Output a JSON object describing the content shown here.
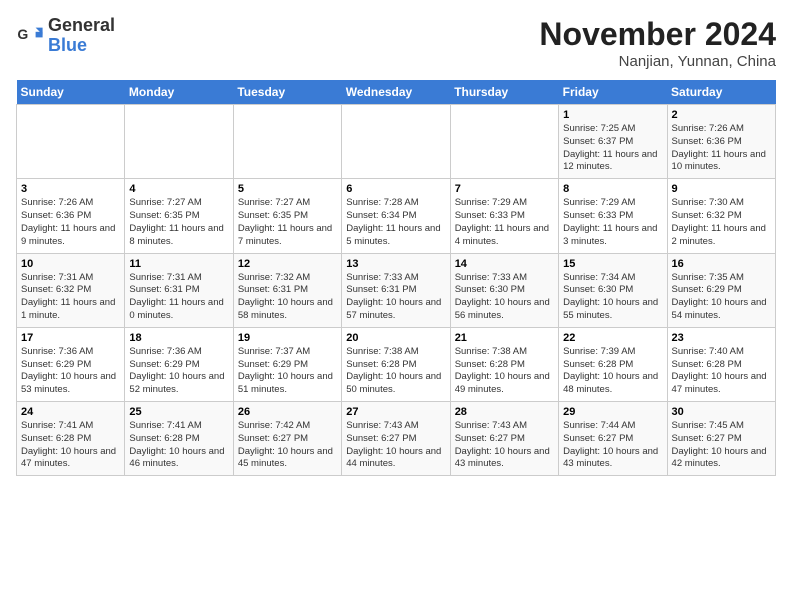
{
  "header": {
    "logo_general": "General",
    "logo_blue": "Blue",
    "month_title": "November 2024",
    "location": "Nanjian, Yunnan, China"
  },
  "days_of_week": [
    "Sunday",
    "Monday",
    "Tuesday",
    "Wednesday",
    "Thursday",
    "Friday",
    "Saturday"
  ],
  "weeks": [
    [
      {
        "day": "",
        "info": ""
      },
      {
        "day": "",
        "info": ""
      },
      {
        "day": "",
        "info": ""
      },
      {
        "day": "",
        "info": ""
      },
      {
        "day": "",
        "info": ""
      },
      {
        "day": "1",
        "info": "Sunrise: 7:25 AM\nSunset: 6:37 PM\nDaylight: 11 hours and 12 minutes."
      },
      {
        "day": "2",
        "info": "Sunrise: 7:26 AM\nSunset: 6:36 PM\nDaylight: 11 hours and 10 minutes."
      }
    ],
    [
      {
        "day": "3",
        "info": "Sunrise: 7:26 AM\nSunset: 6:36 PM\nDaylight: 11 hours and 9 minutes."
      },
      {
        "day": "4",
        "info": "Sunrise: 7:27 AM\nSunset: 6:35 PM\nDaylight: 11 hours and 8 minutes."
      },
      {
        "day": "5",
        "info": "Sunrise: 7:27 AM\nSunset: 6:35 PM\nDaylight: 11 hours and 7 minutes."
      },
      {
        "day": "6",
        "info": "Sunrise: 7:28 AM\nSunset: 6:34 PM\nDaylight: 11 hours and 5 minutes."
      },
      {
        "day": "7",
        "info": "Sunrise: 7:29 AM\nSunset: 6:33 PM\nDaylight: 11 hours and 4 minutes."
      },
      {
        "day": "8",
        "info": "Sunrise: 7:29 AM\nSunset: 6:33 PM\nDaylight: 11 hours and 3 minutes."
      },
      {
        "day": "9",
        "info": "Sunrise: 7:30 AM\nSunset: 6:32 PM\nDaylight: 11 hours and 2 minutes."
      }
    ],
    [
      {
        "day": "10",
        "info": "Sunrise: 7:31 AM\nSunset: 6:32 PM\nDaylight: 11 hours and 1 minute."
      },
      {
        "day": "11",
        "info": "Sunrise: 7:31 AM\nSunset: 6:31 PM\nDaylight: 11 hours and 0 minutes."
      },
      {
        "day": "12",
        "info": "Sunrise: 7:32 AM\nSunset: 6:31 PM\nDaylight: 10 hours and 58 minutes."
      },
      {
        "day": "13",
        "info": "Sunrise: 7:33 AM\nSunset: 6:31 PM\nDaylight: 10 hours and 57 minutes."
      },
      {
        "day": "14",
        "info": "Sunrise: 7:33 AM\nSunset: 6:30 PM\nDaylight: 10 hours and 56 minutes."
      },
      {
        "day": "15",
        "info": "Sunrise: 7:34 AM\nSunset: 6:30 PM\nDaylight: 10 hours and 55 minutes."
      },
      {
        "day": "16",
        "info": "Sunrise: 7:35 AM\nSunset: 6:29 PM\nDaylight: 10 hours and 54 minutes."
      }
    ],
    [
      {
        "day": "17",
        "info": "Sunrise: 7:36 AM\nSunset: 6:29 PM\nDaylight: 10 hours and 53 minutes."
      },
      {
        "day": "18",
        "info": "Sunrise: 7:36 AM\nSunset: 6:29 PM\nDaylight: 10 hours and 52 minutes."
      },
      {
        "day": "19",
        "info": "Sunrise: 7:37 AM\nSunset: 6:29 PM\nDaylight: 10 hours and 51 minutes."
      },
      {
        "day": "20",
        "info": "Sunrise: 7:38 AM\nSunset: 6:28 PM\nDaylight: 10 hours and 50 minutes."
      },
      {
        "day": "21",
        "info": "Sunrise: 7:38 AM\nSunset: 6:28 PM\nDaylight: 10 hours and 49 minutes."
      },
      {
        "day": "22",
        "info": "Sunrise: 7:39 AM\nSunset: 6:28 PM\nDaylight: 10 hours and 48 minutes."
      },
      {
        "day": "23",
        "info": "Sunrise: 7:40 AM\nSunset: 6:28 PM\nDaylight: 10 hours and 47 minutes."
      }
    ],
    [
      {
        "day": "24",
        "info": "Sunrise: 7:41 AM\nSunset: 6:28 PM\nDaylight: 10 hours and 47 minutes."
      },
      {
        "day": "25",
        "info": "Sunrise: 7:41 AM\nSunset: 6:28 PM\nDaylight: 10 hours and 46 minutes."
      },
      {
        "day": "26",
        "info": "Sunrise: 7:42 AM\nSunset: 6:27 PM\nDaylight: 10 hours and 45 minutes."
      },
      {
        "day": "27",
        "info": "Sunrise: 7:43 AM\nSunset: 6:27 PM\nDaylight: 10 hours and 44 minutes."
      },
      {
        "day": "28",
        "info": "Sunrise: 7:43 AM\nSunset: 6:27 PM\nDaylight: 10 hours and 43 minutes."
      },
      {
        "day": "29",
        "info": "Sunrise: 7:44 AM\nSunset: 6:27 PM\nDaylight: 10 hours and 43 minutes."
      },
      {
        "day": "30",
        "info": "Sunrise: 7:45 AM\nSunset: 6:27 PM\nDaylight: 10 hours and 42 minutes."
      }
    ]
  ]
}
